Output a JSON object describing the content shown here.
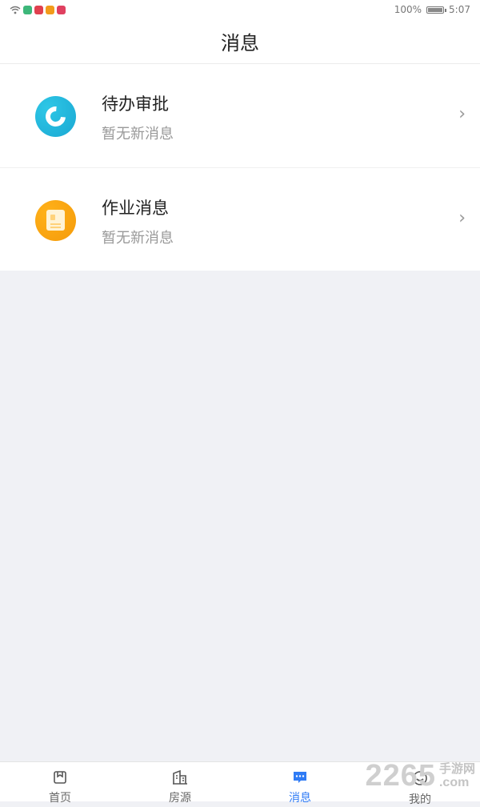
{
  "status_bar": {
    "battery_text": "100%",
    "time": "5:07",
    "app_icon_colors": [
      "#3db77a",
      "#e0404f",
      "#f29b1a",
      "#e04060"
    ]
  },
  "header": {
    "title": "消息"
  },
  "messages": [
    {
      "title": "待办审批",
      "subtitle": "暂无新消息",
      "icon": "approval-icon",
      "color": "#1fb4de"
    },
    {
      "title": "作业消息",
      "subtitle": "暂无新消息",
      "icon": "homework-icon",
      "color": "#f7a30d"
    }
  ],
  "tabbar": {
    "tabs": [
      {
        "label": "首页",
        "icon": "home-icon",
        "active": false
      },
      {
        "label": "房源",
        "icon": "building-icon",
        "active": false
      },
      {
        "label": "消息",
        "icon": "message-icon",
        "active": true
      },
      {
        "label": "我的",
        "icon": "profile-icon",
        "active": false
      }
    ],
    "active_color": "#2f7bf5"
  },
  "watermark": {
    "number": "2265",
    "text": "手游网",
    "domain": ".com"
  }
}
